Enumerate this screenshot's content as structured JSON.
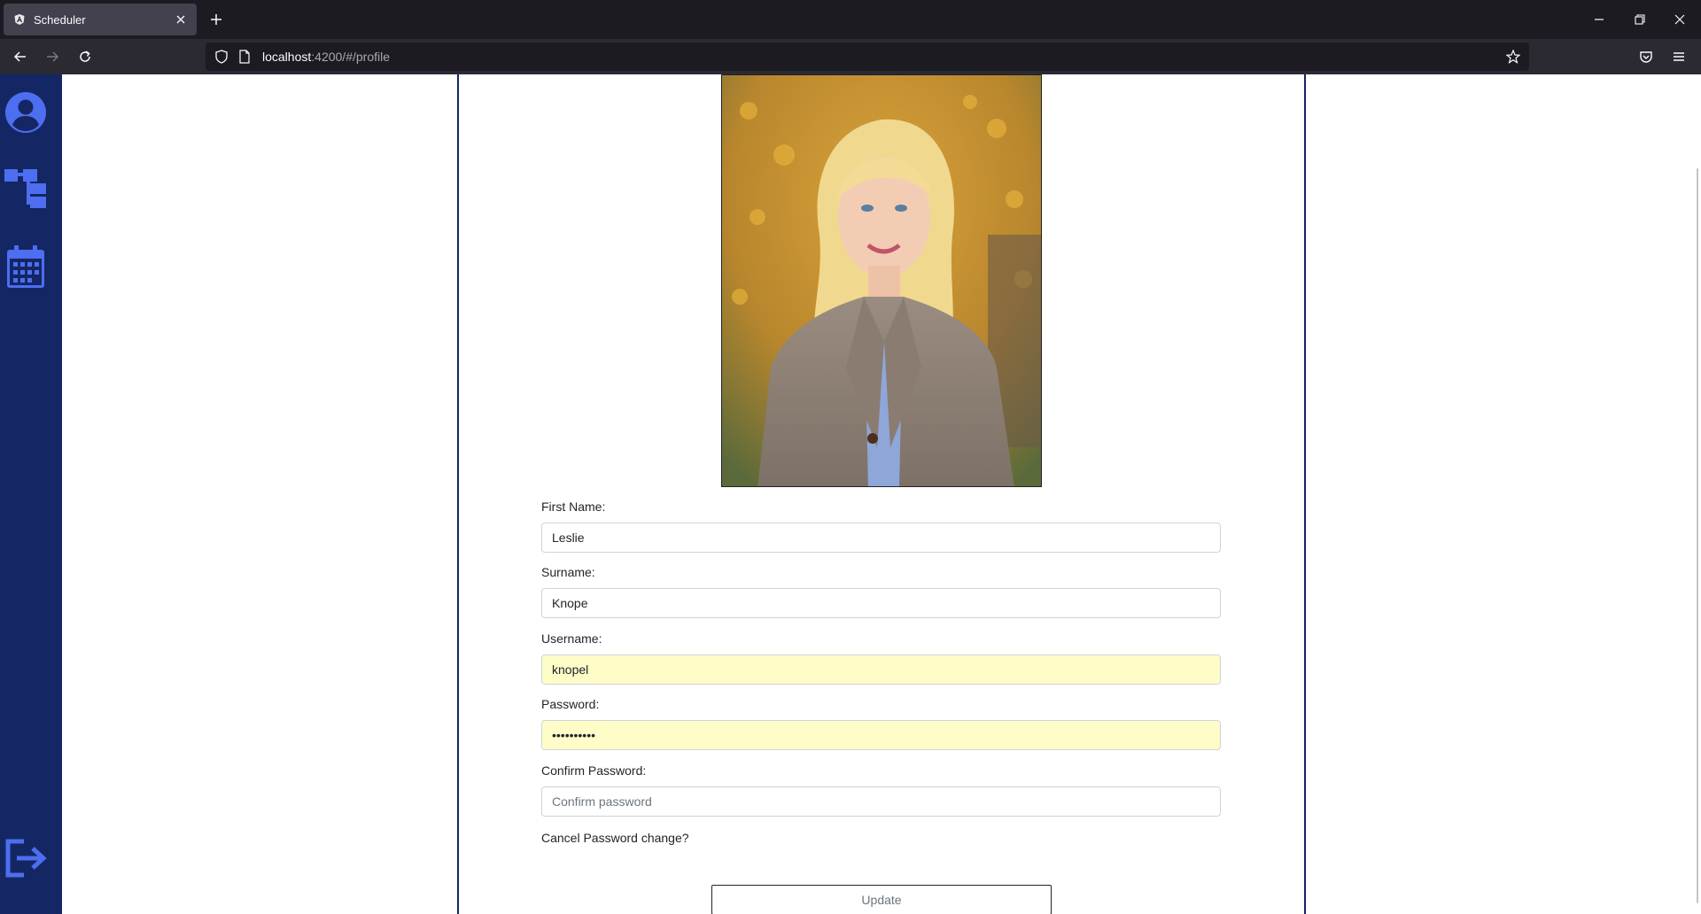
{
  "browser": {
    "tab_title": "Scheduler",
    "url_host": "localhost",
    "url_path": ":4200/#/profile",
    "icons": [
      "angular-icon",
      "close-icon",
      "plus-icon",
      "minimize-icon",
      "restore-icon",
      "window-close-icon",
      "back-icon",
      "forward-icon",
      "reload-icon",
      "shield-icon",
      "page-icon",
      "star-icon",
      "pocket-icon",
      "menu-icon"
    ]
  },
  "sidebar": {
    "background": "#142764",
    "icon_color": "#4d6ef0",
    "items": [
      {
        "name": "profile",
        "icon": "user-circle-icon"
      },
      {
        "name": "hierarchy",
        "icon": "sitemap-icon"
      },
      {
        "name": "calendar",
        "icon": "calendar-icon"
      },
      {
        "name": "logout",
        "icon": "logout-icon"
      }
    ]
  },
  "profile": {
    "photo_alt": "profile-photo",
    "first_name_label": "First Name:",
    "first_name_value": "Leslie",
    "surname_label": "Surname:",
    "surname_value": "Knope",
    "username_label": "Username:",
    "username_value": "knopel",
    "password_label": "Password:",
    "password_value": "••••••••••",
    "confirm_label": "Confirm Password:",
    "confirm_placeholder": "Confirm password",
    "cancel_link": "Cancel Password change?",
    "update_button": "Update"
  },
  "colors": {
    "autofill": "#fefdc8",
    "card_border": "#142764"
  }
}
